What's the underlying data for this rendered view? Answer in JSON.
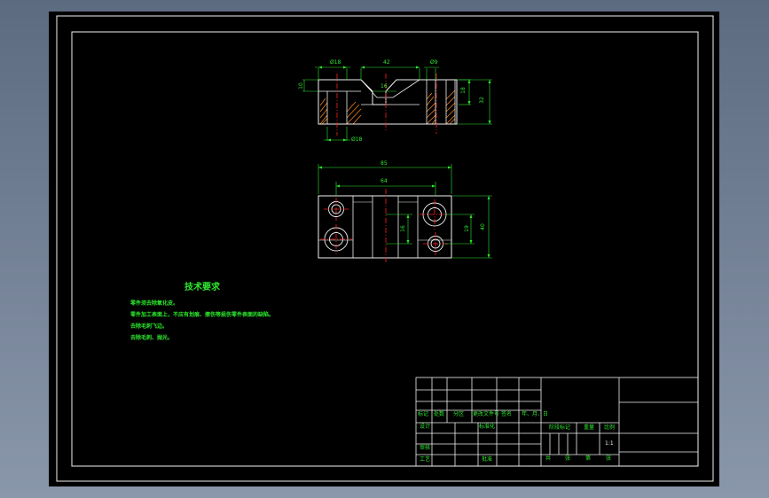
{
  "dims_front": {
    "d1": "Ø18",
    "d2": "42",
    "d3": "Ø9",
    "d4": "16",
    "d5": "10",
    "d6": "18",
    "d7": "32",
    "d8": "Ø18"
  },
  "dims_top": {
    "d1": "85",
    "d2": "64",
    "d3": "16",
    "d4": "19",
    "d5": "40"
  },
  "tech": {
    "title": "技术要求",
    "notes": [
      "零件须去除氧化皮。",
      "零件加工表面上，不应有划痕、擦伤等损伤零件表面的缺陷。",
      "去除毛刺飞边。",
      "去除毛刺、抛光。"
    ]
  },
  "title_block": {
    "row1": [
      "标记",
      "处数",
      "分区",
      "更改文件号",
      "签名",
      "年、月、日"
    ],
    "design": "设计",
    "standard": "标准化",
    "review": "审核",
    "process": "工艺",
    "approve": "批准",
    "stage": "阶段标记",
    "weight": "重量",
    "scale": "比例",
    "scale_value": "1:1",
    "sheets": [
      "共",
      "张",
      "第",
      "张"
    ]
  },
  "colors": {
    "green": "#2ee82e",
    "white": "#f2f2f2",
    "red": "#ff2020",
    "hatch": "#ff8c1a"
  }
}
